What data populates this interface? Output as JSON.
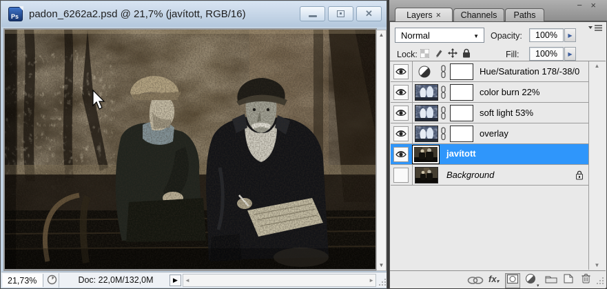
{
  "window": {
    "title": "padon_6262a2.psd @ 21,7% (javított, RGB/16)",
    "file_icon_label": "Ps",
    "status": {
      "zoom": "21,73%",
      "doc": "Doc: 22,0M/132,0M"
    }
  },
  "panel": {
    "controls": {
      "minimize": "−",
      "close": "×"
    },
    "tabs": [
      {
        "label": "Layers",
        "close": "×",
        "active": true
      },
      {
        "label": "Channels",
        "active": false
      },
      {
        "label": "Paths",
        "active": false
      }
    ],
    "blend_mode": {
      "value": "Normal"
    },
    "opacity": {
      "label": "Opacity:",
      "value": "100%"
    },
    "lock": {
      "label": "Lock:"
    },
    "fill": {
      "label": "Fill:",
      "value": "100%"
    },
    "layers": [
      {
        "label": "Hue/Saturation 178/-38/0",
        "visible": true,
        "type": "adjustment",
        "has_mask": true
      },
      {
        "label": "color burn 22%",
        "visible": true,
        "type": "image",
        "has_mask": true
      },
      {
        "label": "soft light 53%",
        "visible": true,
        "type": "image",
        "has_mask": true
      },
      {
        "label": "overlay",
        "visible": true,
        "type": "image",
        "has_mask": true
      },
      {
        "label": "javított",
        "visible": true,
        "type": "image",
        "selected": true
      },
      {
        "label": "Background",
        "visible": false,
        "type": "background",
        "locked": true
      }
    ],
    "footer_fx_label": "fx"
  },
  "icons": {
    "combo_arrow": "▼",
    "spin_arrow": "▶",
    "flyout_arrow": "▶",
    "up_arrow": "▲",
    "down_arrow": "▼",
    "left_arrow": "◄",
    "right_arrow": "►"
  },
  "colors": {
    "selection_blue": "#2f96fb",
    "titlebar": "#c6d6e8",
    "panel_bg": "#e9e9e9",
    "desktop": "#3b3b3b"
  }
}
